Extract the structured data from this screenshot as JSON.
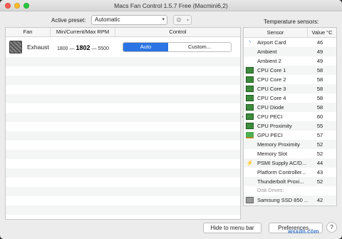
{
  "window": {
    "title": "Macs Fan Control 1.5.7 Free (Macmini6,2)"
  },
  "toolbar": {
    "preset_label": "Active preset:",
    "preset_value": "Automatic",
    "gear_icon": "gear-icon",
    "temp_label": "Temperature sensors:"
  },
  "fans": {
    "headers": [
      "Fan",
      "Min/Current/Max RPM",
      "Control"
    ],
    "items": [
      {
        "name": "Exhaust",
        "min": "1800",
        "current": "1802",
        "max": "5500",
        "auto_label": "Auto",
        "custom_label": "Custom..."
      }
    ]
  },
  "sensors": {
    "headers": [
      "Sensor",
      "Value °C"
    ],
    "items": [
      {
        "icon": "wifi-icon",
        "name": "Airport Card",
        "value": "46"
      },
      {
        "icon": "",
        "name": "Ambient",
        "value": "49"
      },
      {
        "icon": "",
        "name": "Ambient 2",
        "value": "49"
      },
      {
        "icon": "chip-icon",
        "name": "CPU Core 1",
        "value": "58"
      },
      {
        "icon": "chip-icon",
        "name": "CPU Core 2",
        "value": "58"
      },
      {
        "icon": "chip-icon",
        "name": "CPU Core 3",
        "value": "58"
      },
      {
        "icon": "chip-icon",
        "name": "CPU Core 4",
        "value": "58"
      },
      {
        "icon": "chip-icon",
        "name": "CPU Diode",
        "value": "58"
      },
      {
        "icon": "chip-icon",
        "name": "CPU PECI",
        "value": "60"
      },
      {
        "icon": "chip-icon",
        "name": "CPU Proximity",
        "value": "55"
      },
      {
        "icon": "pci-icon",
        "name": "GPU PECI",
        "value": "57"
      },
      {
        "icon": "",
        "name": "Memory Proximity",
        "value": "52"
      },
      {
        "icon": "",
        "name": "Memory Slot",
        "value": "52"
      },
      {
        "icon": "bolt-icon",
        "name": "PSMI Supply AC/D...",
        "value": "44"
      },
      {
        "icon": "",
        "name": "Platform Controller...",
        "value": "43"
      },
      {
        "icon": "",
        "name": "Thunderbolt Proxi...",
        "value": "52"
      },
      {
        "icon": "",
        "name": "Disk Drives:",
        "value": "",
        "group": true
      },
      {
        "icon": "ssd-icon",
        "name": "Samsung SSD 850 ...",
        "value": "42"
      }
    ]
  },
  "footer": {
    "hide_label": "Hide to menu bar",
    "prefs_label": "Preferences...",
    "help_label": "?"
  },
  "watermark": "wsxdn.com"
}
